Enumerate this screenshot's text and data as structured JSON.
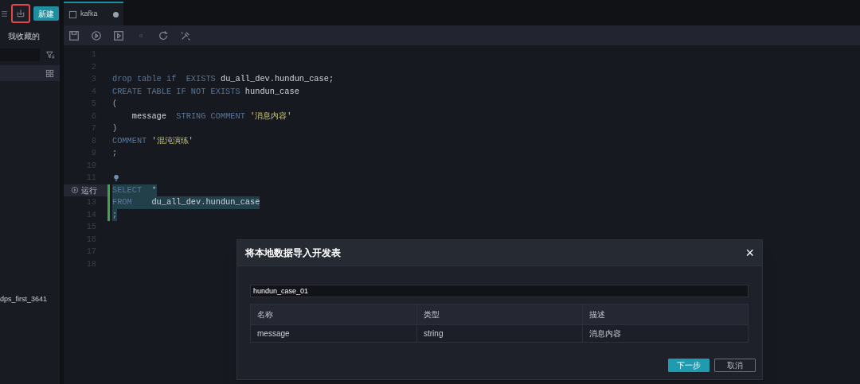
{
  "sidebar": {
    "new_button": "新建",
    "favorites_tab": "我收藏的",
    "items": [
      {
        "label": "dps_first_3641"
      }
    ]
  },
  "tabs": [
    {
      "label": "kafka",
      "modified": true,
      "selected": true
    }
  ],
  "editor": {
    "lines": [
      {
        "number": "1",
        "selected": false
      },
      {
        "number": "2",
        "selected": false
      },
      {
        "number": "3",
        "selected": false,
        "tokens": [
          {
            "text": "drop table if  EXISTS ",
            "kind": "keyword"
          },
          {
            "text": "du_all_dev.hundun_case;",
            "kind": "ident"
          }
        ]
      },
      {
        "number": "4",
        "selected": false,
        "tokens": [
          {
            "text": "CREATE TABLE IF NOT EXISTS ",
            "kind": "keyword"
          },
          {
            "text": "hundun_case",
            "kind": "ident"
          }
        ]
      },
      {
        "number": "5",
        "selected": false,
        "tokens": [
          {
            "text": "(",
            "kind": "punct"
          }
        ]
      },
      {
        "number": "6",
        "selected": false,
        "tokens": [
          {
            "text": "    message  ",
            "kind": "ident"
          },
          {
            "text": "STRING COMMENT ",
            "kind": "keyword"
          },
          {
            "text": "'消息内容'",
            "kind": "string"
          }
        ]
      },
      {
        "number": "7",
        "selected": false,
        "tokens": [
          {
            "text": ")",
            "kind": "punct"
          }
        ]
      },
      {
        "number": "8",
        "selected": false,
        "tokens": [
          {
            "text": "COMMENT ",
            "kind": "keyword"
          },
          {
            "text": "'混沌演练'",
            "kind": "string"
          }
        ]
      },
      {
        "number": "9",
        "selected": false,
        "tokens": [
          {
            "text": ";",
            "kind": "punct"
          }
        ]
      },
      {
        "number": "10",
        "selected": false
      },
      {
        "number": "11",
        "selected": false,
        "hint": true
      },
      {
        "selected": true,
        "run_label": "运行",
        "tokens": [
          {
            "text": "SELECT  ",
            "kind": "keyword"
          },
          {
            "text": "*",
            "kind": "punct"
          }
        ]
      },
      {
        "number": "13",
        "selected": true,
        "tokens": [
          {
            "text": "FROM    ",
            "kind": "keyword"
          },
          {
            "text": "du_all_dev.hundun_case",
            "kind": "ident"
          }
        ]
      },
      {
        "number": "14",
        "selected": true,
        "tokens": [
          {
            "text": ";",
            "kind": "punct"
          }
        ]
      },
      {
        "number": "15",
        "selected": false
      },
      {
        "number": "16",
        "selected": false
      },
      {
        "number": "17",
        "selected": false
      },
      {
        "number": "18",
        "selected": false
      }
    ]
  },
  "dialog": {
    "title": "将本地数据导入开发表",
    "close": "×",
    "table_name": "hundun_case_01",
    "table": {
      "columns": [
        "名称",
        "类型",
        "描述"
      ],
      "rows": [
        [
          "message",
          "string",
          "消息内容"
        ]
      ]
    },
    "buttons": [
      {
        "label": "下一步",
        "kind": "primary"
      },
      {
        "label": "取消",
        "kind": "secondary"
      }
    ]
  }
}
